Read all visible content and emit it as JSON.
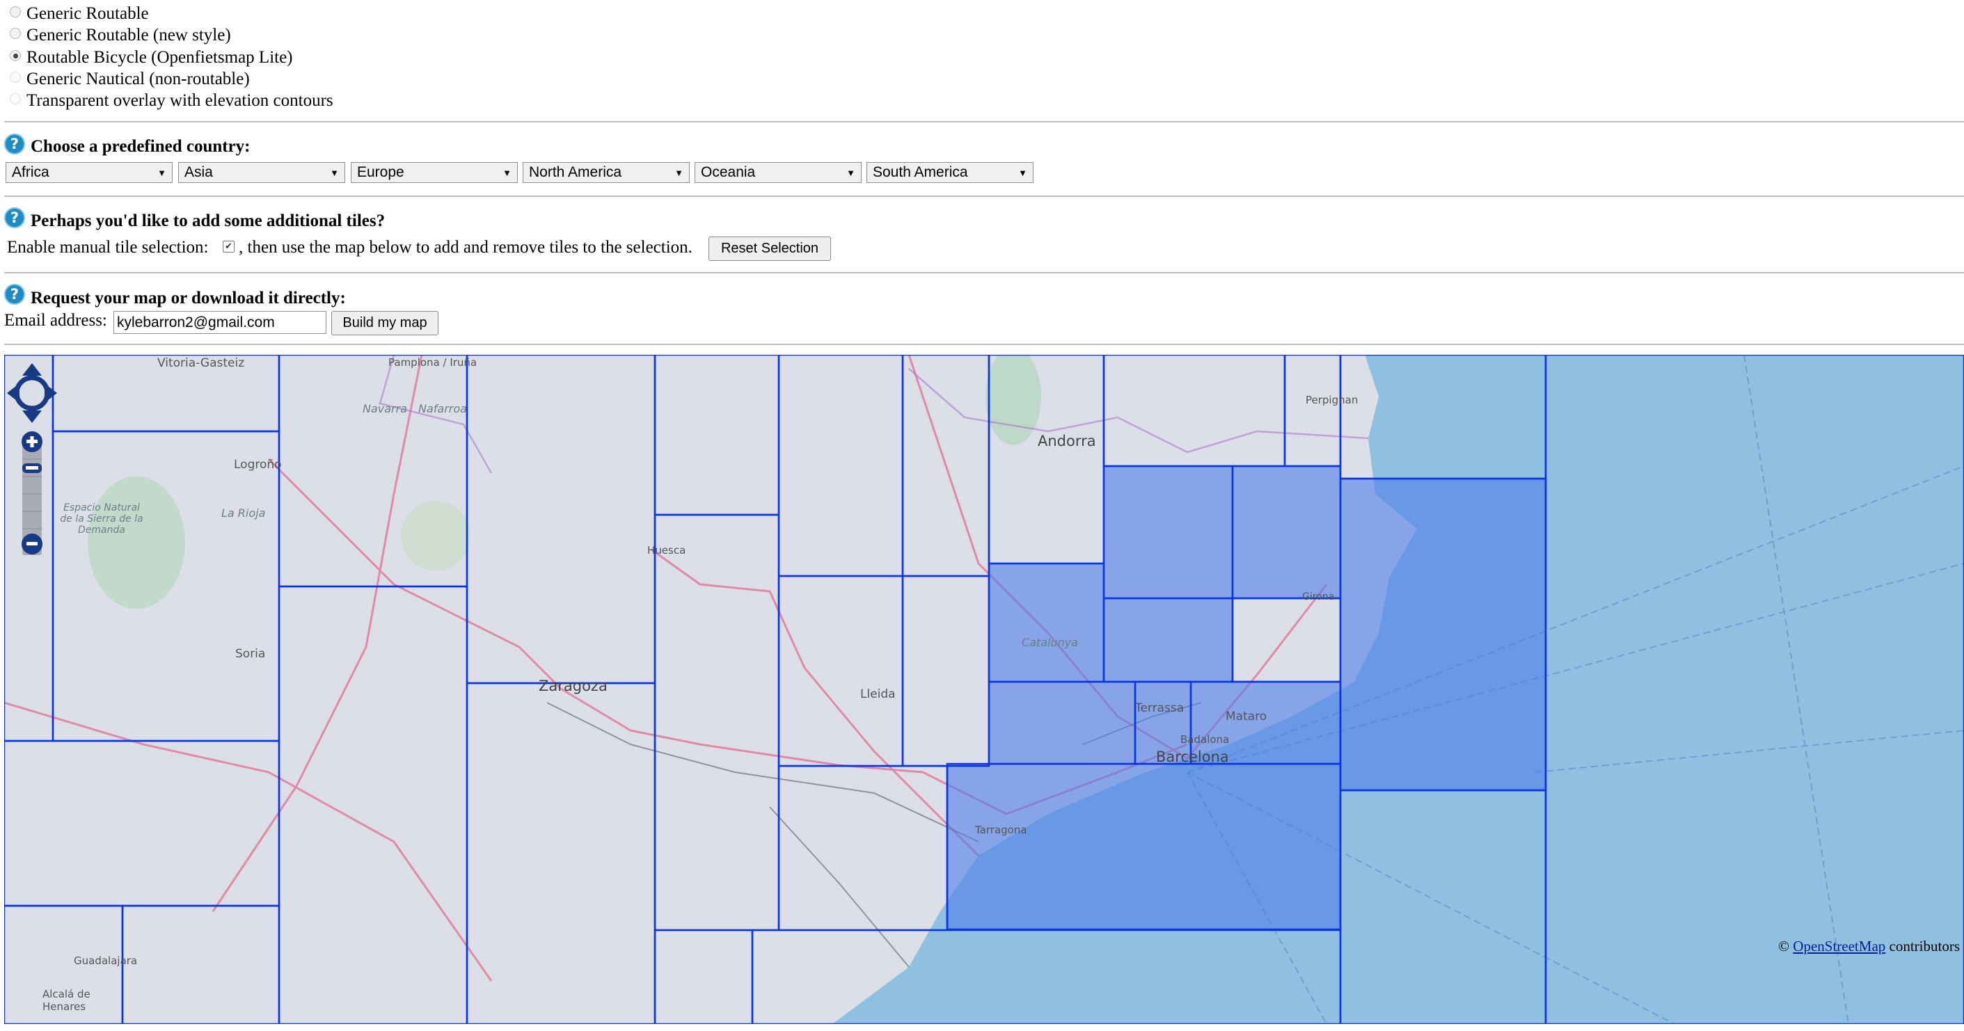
{
  "styles": {
    "options": [
      {
        "label": "Generic Routable",
        "selected": false
      },
      {
        "label": "Generic Routable (new style)",
        "selected": false
      },
      {
        "label": "Routable Bicycle (Openfietsmap Lite)",
        "selected": true
      },
      {
        "label": "Generic Nautical (non-routable)",
        "selected": false
      },
      {
        "label": "Transparent overlay with elevation contours",
        "selected": false
      }
    ]
  },
  "country": {
    "heading": "Choose a predefined country:",
    "selects": [
      "Africa",
      "Asia",
      "Europe",
      "North America",
      "Oceania",
      "South America"
    ]
  },
  "tiles": {
    "heading": "Perhaps you'd like to add some additional tiles?",
    "enable_label": "Enable manual tile selection:",
    "enable_checked": true,
    "after_text": ", then use the map below to add and remove tiles to the selection.",
    "reset_label": "Reset Selection"
  },
  "request": {
    "heading": "Request your map or download it directly:",
    "email_label": "Email address:",
    "email_value": "kylebarron2@gmail.com",
    "build_label": "Build my map"
  },
  "map": {
    "place_labels": [
      "Vitoria-Gasteiz",
      "Pamplona / Iruña",
      "Navarra",
      "Nafarroa",
      "Logroño",
      "La Rioja",
      "Espacio Natural de la Sierra de la Demanda",
      "Soria",
      "Zaragoza",
      "Huesca",
      "Andorra",
      "Perpignan",
      "Catalunya",
      "Lleida",
      "Girona",
      "Terrassa",
      "Mataro",
      "Badalona",
      "Barcelona",
      "Tarragona",
      "Guadalajara",
      "Alcalá de Henares"
    ],
    "attribution_link": "OpenStreetMap",
    "attribution_suffix": " contributors"
  },
  "colors": {
    "tile_border": "#0b35e0",
    "selected_fill": "#4f7dea",
    "sea": "#8fc0e0",
    "help_icon": "#1e8bc3"
  },
  "icons": {
    "pan": "pan-arrows-icon",
    "zoom_in": "zoom-in-icon",
    "zoom_out": "zoom-out-icon",
    "help": "help-icon"
  }
}
